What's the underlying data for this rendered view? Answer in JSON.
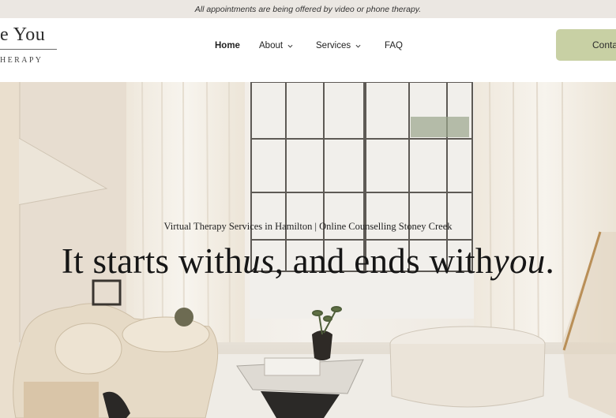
{
  "announcement": "All appointments are being offered by video or phone therapy.",
  "logo": {
    "name": "e You",
    "subtitle": "HERAPY"
  },
  "nav": {
    "items": [
      {
        "label": "Home",
        "active": true,
        "has_dropdown": false
      },
      {
        "label": "About",
        "active": false,
        "has_dropdown": true
      },
      {
        "label": "Services",
        "active": false,
        "has_dropdown": true
      },
      {
        "label": "FAQ",
        "active": false,
        "has_dropdown": false
      }
    ],
    "contact_label": "Conta"
  },
  "hero": {
    "subtitle": "Virtual Therapy Services in Hamilton | Online Counselling Stoney Creek",
    "title_part1": "It starts with",
    "title_italic1": "us",
    "title_part2": ", and ends with",
    "title_italic2": "you",
    "title_part3": "."
  },
  "colors": {
    "announcement_bg": "#ebe7e2",
    "contact_button_bg": "#c8d0a4",
    "text_dark": "#161616"
  }
}
